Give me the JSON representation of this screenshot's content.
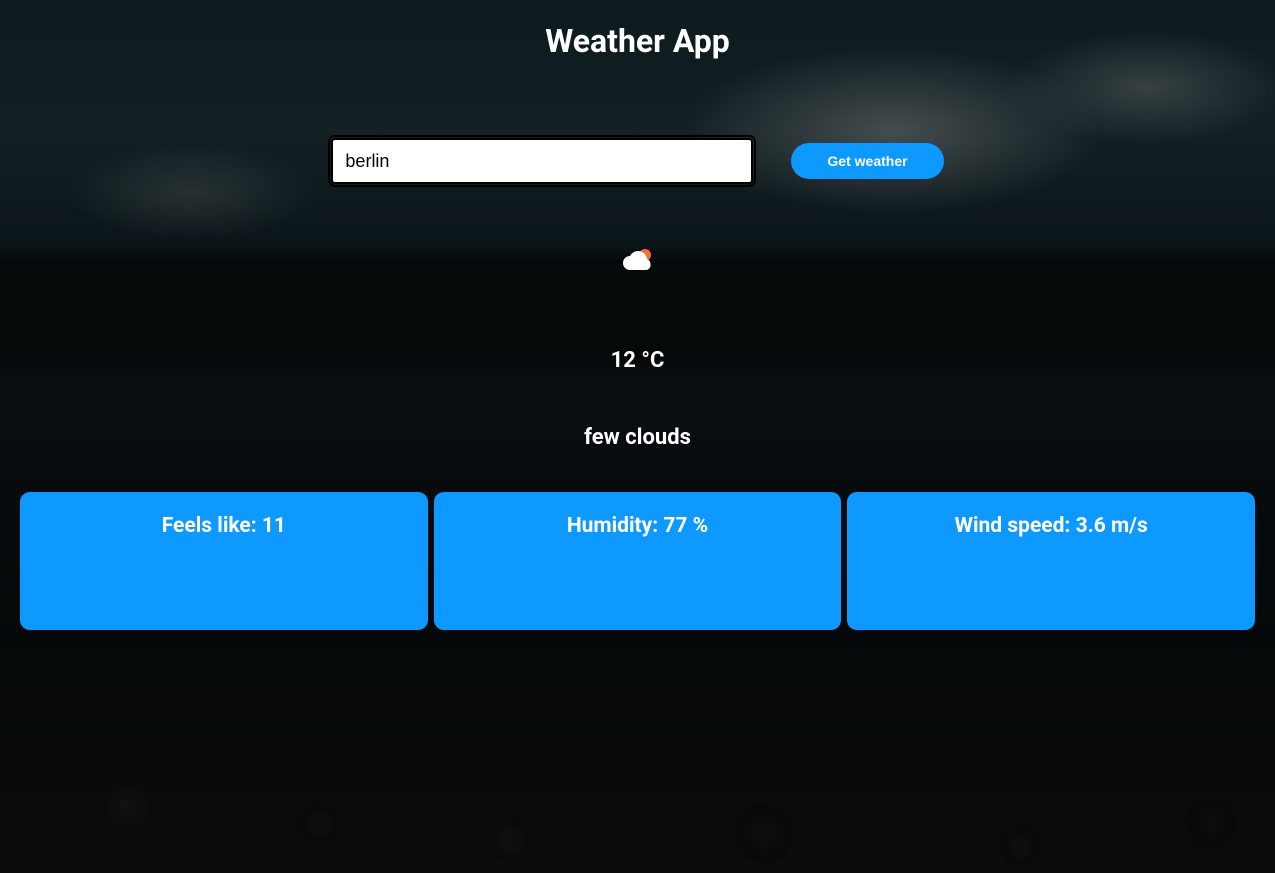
{
  "app": {
    "title": "Weather App"
  },
  "search": {
    "city_value": "berlin",
    "placeholder": "",
    "button_label": "Get weather"
  },
  "weather": {
    "icon": "few-clouds-icon",
    "temperature_display": "12 °C",
    "description": "few clouds",
    "feels_like_display": "Feels like: 11",
    "humidity_display": "Humidity: 77 %",
    "wind_speed_display": "Wind speed: 3.6 m/s"
  },
  "colors": {
    "accent": "#0d99ff"
  }
}
